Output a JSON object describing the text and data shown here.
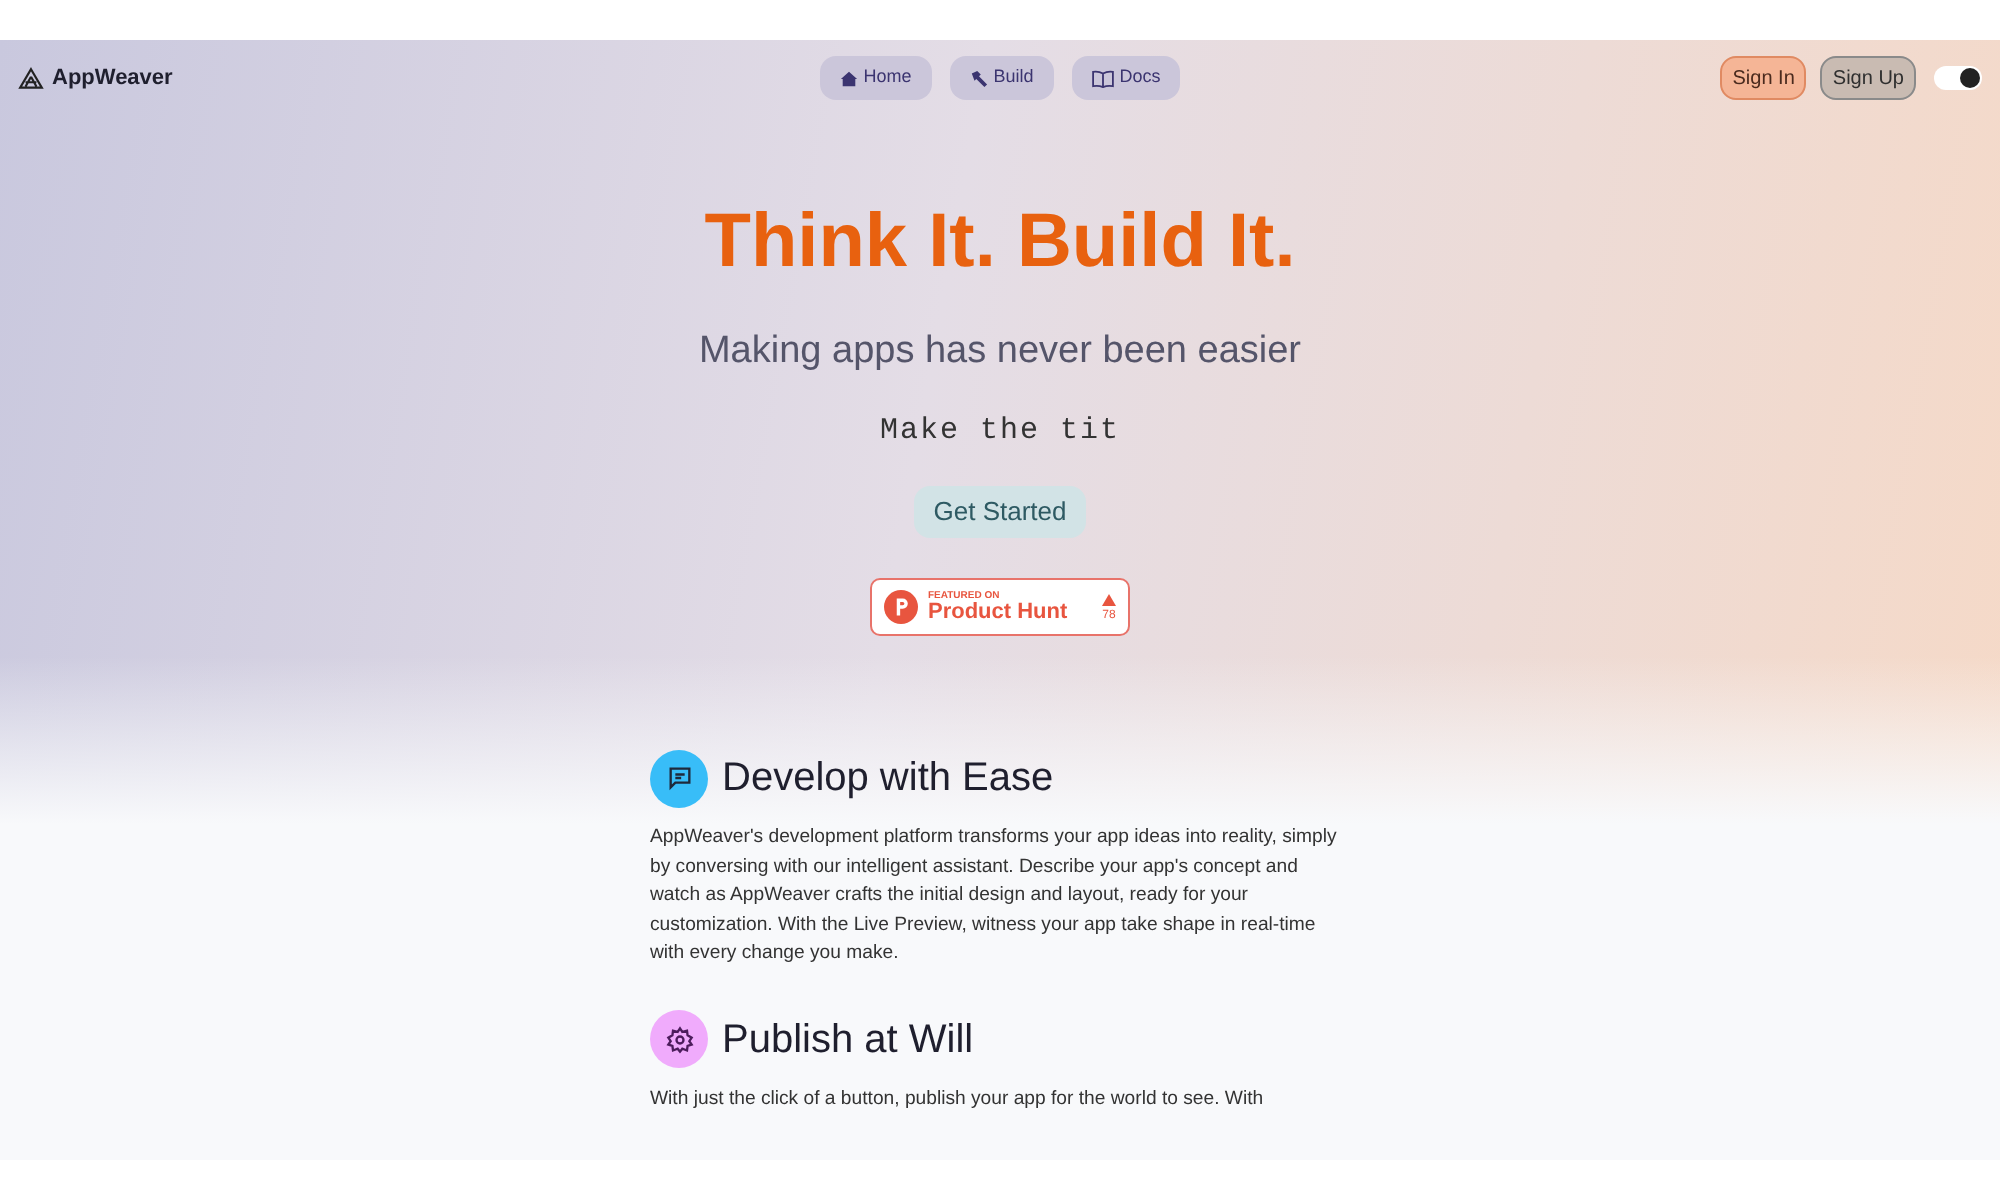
{
  "brand": {
    "name": "AppWeaver"
  },
  "nav": [
    {
      "label": "Home",
      "kind": "home"
    },
    {
      "label": "Build",
      "kind": "build"
    },
    {
      "label": "Docs",
      "kind": "docs"
    }
  ],
  "auth": [
    {
      "label": "Sign In",
      "kind": "signin"
    },
    {
      "label": "Sign Up",
      "kind": "signup"
    }
  ],
  "theme_toggle": {
    "on": true
  },
  "hero": {
    "title": "Think It. Build It.",
    "subtitle": "Making apps has never been easier",
    "typing": "Make the tit",
    "cta": "Get Started",
    "badge": {
      "featured": "FEATURED ON",
      "name": "Product Hunt",
      "votes": "78"
    }
  },
  "features": [
    {
      "title": "Develop with Ease",
      "kind": "chat",
      "color": "#38bdf8",
      "text": "AppWeaver's development platform transforms your app ideas into reality, simply by conversing with our intelligent assistant. Describe your app's concept and watch as AppWeaver crafts the initial design and layout, ready for your customization. With the Live Preview, witness your app take shape in real-time with every change you make."
    },
    {
      "title": "Publish at Will",
      "kind": "gear",
      "color": "#f0abfc",
      "text": "With just the click of a button, publish your app for the world to see. With"
    }
  ]
}
